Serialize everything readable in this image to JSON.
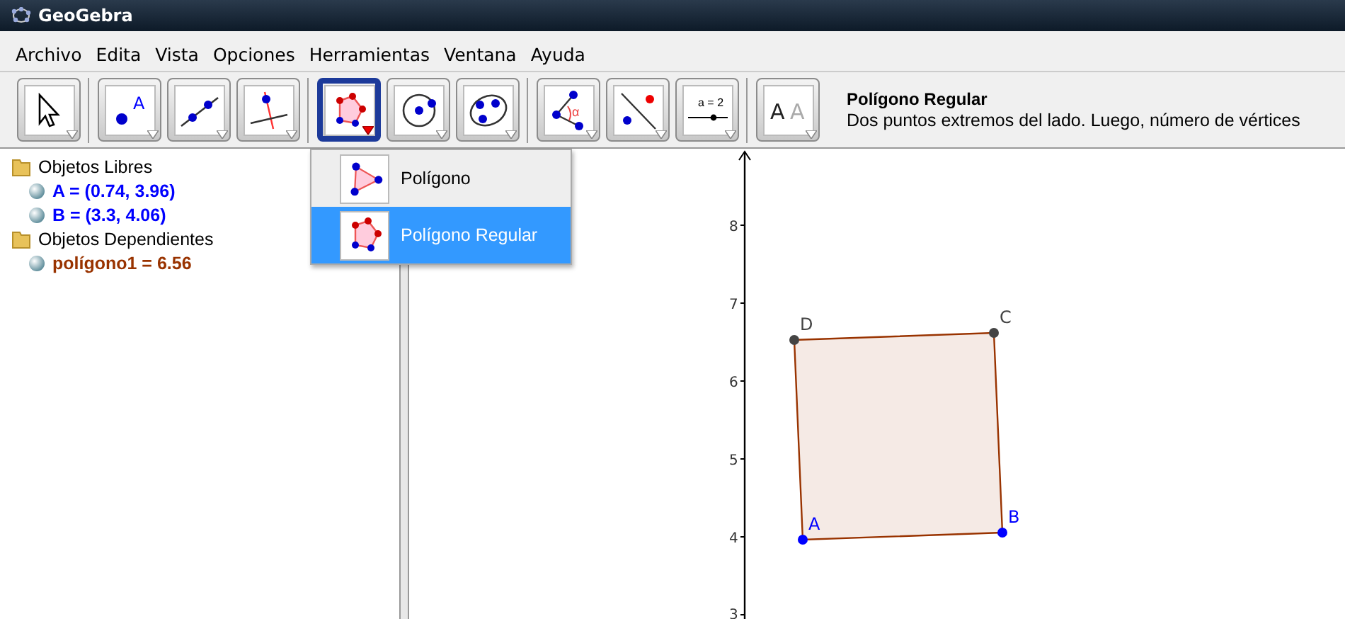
{
  "window": {
    "title": "GeoGebra"
  },
  "menu": [
    "Archivo",
    "Edita",
    "Vista",
    "Opciones",
    "Herramientas",
    "Ventana",
    "Ayuda"
  ],
  "toolbar": {
    "groups": [
      {
        "tools": [
          {
            "kind": "move",
            "selected": false
          }
        ]
      },
      {
        "tools": [
          {
            "kind": "point",
            "selected": false,
            "label": "A"
          },
          {
            "kind": "line",
            "selected": false
          },
          {
            "kind": "perpendicular",
            "selected": false
          }
        ]
      },
      {
        "tools": [
          {
            "kind": "polygon",
            "selected": true
          },
          {
            "kind": "circle",
            "selected": false
          },
          {
            "kind": "conic",
            "selected": false
          }
        ]
      },
      {
        "tools": [
          {
            "kind": "angle",
            "selected": false,
            "label": "α"
          },
          {
            "kind": "reflect",
            "selected": false
          },
          {
            "kind": "slider",
            "selected": false,
            "label": "a = 2"
          }
        ]
      },
      {
        "tools": [
          {
            "kind": "text",
            "selected": false,
            "label": "A",
            "label2": "A"
          }
        ]
      }
    ],
    "help": {
      "title": "Polígono Regular",
      "description": "Dos puntos extremos del lado. Luego, número de vértices"
    }
  },
  "dropdown": [
    {
      "kind": "polygon",
      "label": "Polígono",
      "selected": false
    },
    {
      "kind": "regular",
      "label": "Polígono Regular",
      "selected": true
    }
  ],
  "algebra": [
    {
      "label": "Objetos Libres",
      "children": [
        {
          "label": "A = (0.74, 3.96)",
          "color": "#0000ff"
        },
        {
          "label": "B = (3.3, 4.06)",
          "color": "#0000ff"
        }
      ]
    },
    {
      "label": "Objetos Dependientes",
      "children": [
        {
          "label": "polígono1 = 6.56",
          "color": "#993300"
        }
      ]
    }
  ],
  "graphics": {
    "y_axis_labels": [
      "8",
      "7",
      "6",
      "5",
      "4",
      "3"
    ],
    "polygon": {
      "color": "#993300"
    },
    "points": [
      {
        "label": "D",
        "color": "#444444"
      },
      {
        "label": "C",
        "color": "#444444"
      },
      {
        "label": "A",
        "color": "#0000ff"
      },
      {
        "label": "B",
        "color": "#0000ff"
      }
    ]
  }
}
